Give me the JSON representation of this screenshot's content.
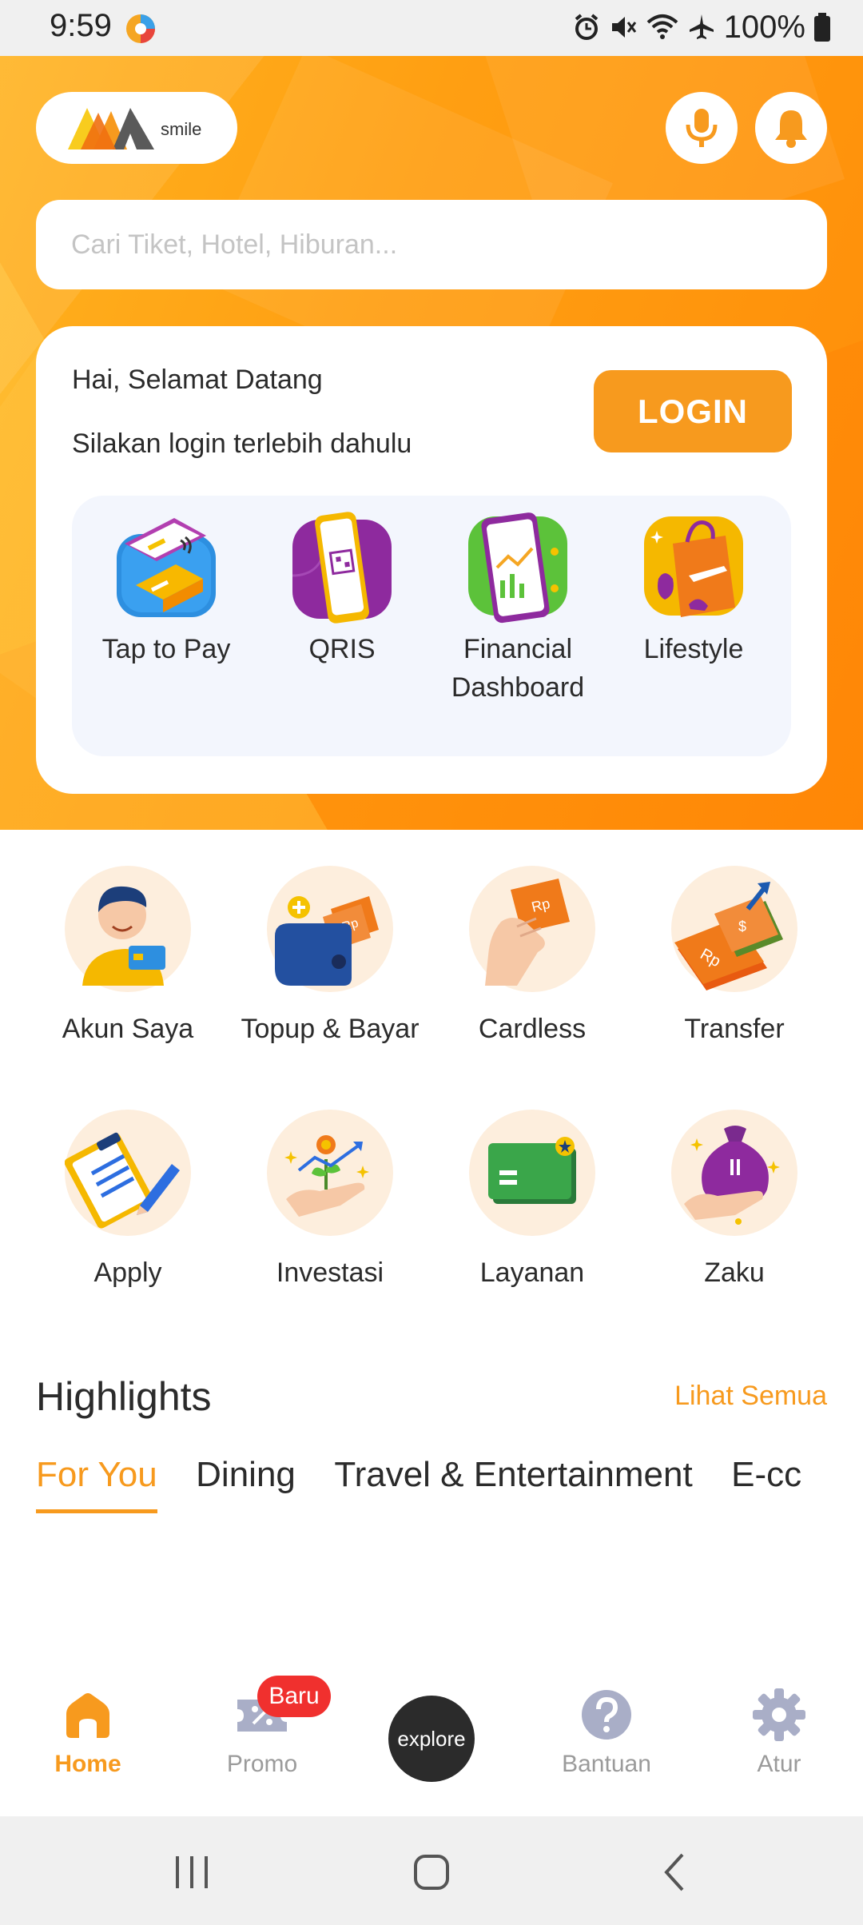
{
  "status_bar": {
    "time": "9:59",
    "battery": "100%"
  },
  "header": {
    "logo_text": "smile",
    "search_placeholder": "Cari Tiket, Hotel, Hiburan..."
  },
  "welcome": {
    "greeting": "Hai, Selamat Datang",
    "subtitle": "Silakan login terlebih dahulu",
    "login_label": "LOGIN"
  },
  "quick_actions": [
    {
      "label": "Tap to Pay",
      "icon": "tap-to-pay-icon"
    },
    {
      "label": "QRIS",
      "icon": "qris-icon"
    },
    {
      "label": "Financial Dashboard",
      "icon": "financial-dashboard-icon"
    },
    {
      "label": "Lifestyle",
      "icon": "lifestyle-icon"
    }
  ],
  "menu": [
    {
      "label": "Akun Saya",
      "icon": "account-icon"
    },
    {
      "label": "Topup & Bayar",
      "icon": "wallet-icon"
    },
    {
      "label": "Cardless",
      "icon": "cardless-icon"
    },
    {
      "label": "Transfer",
      "icon": "transfer-icon"
    },
    {
      "label": "Apply",
      "icon": "apply-icon"
    },
    {
      "label": "Investasi",
      "icon": "investment-icon"
    },
    {
      "label": "Layanan",
      "icon": "service-card-icon"
    },
    {
      "label": "Zaku",
      "icon": "money-bag-icon"
    }
  ],
  "highlights": {
    "title": "Highlights",
    "see_all": "Lihat Semua",
    "tabs": [
      "For You",
      "Dining",
      "Travel & Entertainment",
      "E-cc"
    ],
    "active_tab": "For You"
  },
  "bottom_nav": {
    "items": [
      {
        "label": "Home",
        "icon": "home-icon"
      },
      {
        "label": "Promo",
        "icon": "promo-ticket-icon"
      },
      {
        "label": "explore",
        "icon": "explore-button"
      },
      {
        "label": "Bantuan",
        "icon": "help-icon"
      },
      {
        "label": "Atur",
        "icon": "gear-icon"
      }
    ],
    "promo_badge": "Baru"
  },
  "colors": {
    "accent": "#f79a1e",
    "hero": "#ff9f12",
    "badge": "#f0302e",
    "dark": "#2b2b2b"
  }
}
